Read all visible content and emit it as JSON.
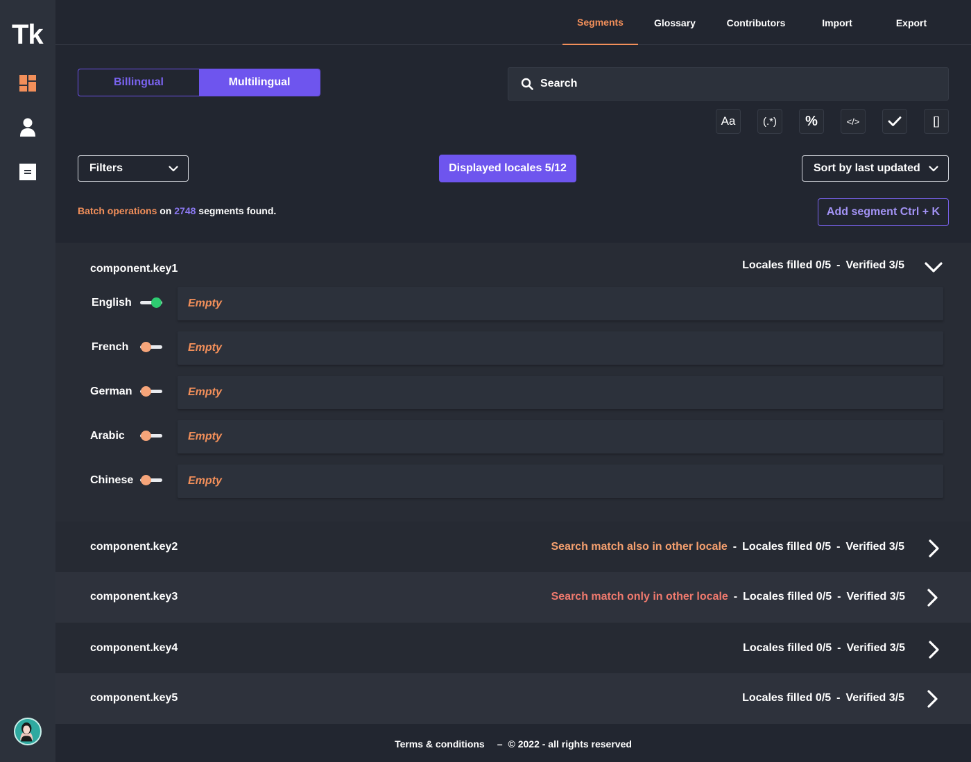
{
  "app": {
    "logo": "Tk"
  },
  "sidebar": {
    "items": [
      {
        "name": "dashboard-icon",
        "color": "#f28f5a"
      },
      {
        "name": "user-icon",
        "color": "#ffffff"
      },
      {
        "name": "document-icon",
        "color": "#ffffff"
      }
    ]
  },
  "nav": {
    "tabs": [
      {
        "label": "Segments",
        "active": true
      },
      {
        "label": "Glossary"
      },
      {
        "label": "Contributors"
      },
      {
        "label": "Import"
      },
      {
        "label": "Export"
      }
    ]
  },
  "mode": {
    "billingual": "Billingual",
    "multilingual": "Multilingual",
    "selected": "Multilingual"
  },
  "search": {
    "placeholder": "Search",
    "options": [
      "Aa",
      "(.*)",
      "%",
      "</>",
      "check-icon",
      "[]"
    ]
  },
  "toolbar": {
    "filters": "Filters",
    "displayed_locales": "Displayed locales 5/12",
    "sort": "Sort by last updated"
  },
  "batch": {
    "link": "Batch operations",
    "on": "on",
    "count": "2748",
    "suffix": "segments found."
  },
  "add_segment": "Add segment Ctrl + K",
  "segments": [
    {
      "key": "component.key1",
      "locales_filled": "Locales filled 0/5",
      "verified": "Verified 3/5",
      "sep": "-",
      "expanded": true,
      "locales": [
        {
          "name": "English",
          "value": "Empty",
          "enabled": true
        },
        {
          "name": "French",
          "value": "Empty",
          "enabled": false
        },
        {
          "name": "German",
          "value": "Empty",
          "enabled": false
        },
        {
          "name": "Arabic",
          "value": "Empty",
          "enabled": false
        },
        {
          "name": "Chinese",
          "value": "Empty",
          "enabled": false
        }
      ]
    },
    {
      "key": "component.key2",
      "match": "Search match also in other locale",
      "locales_filled": "Locales filled 0/5",
      "verified": "Verified 3/5",
      "sep": "-"
    },
    {
      "key": "component.key3",
      "match": "Search match only in other locale",
      "locales_filled": "Locales filled 0/5",
      "verified": "Verified 3/5",
      "sep": "-"
    },
    {
      "key": "component.key4",
      "locales_filled": "Locales filled 0/5",
      "verified": "Verified 3/5",
      "sep": "-"
    },
    {
      "key": "component.key5",
      "locales_filled": "Locales filled 0/5",
      "verified": "Verified 3/5",
      "sep": "-"
    }
  ],
  "footer": {
    "terms": "Terms & conditions",
    "dash": "–",
    "copyright": "© 2022 - all rights reserved"
  },
  "colors": {
    "accent": "#6e55ee",
    "orange": "#f28f5a",
    "switch_on": "#2ecc71",
    "switch_off": "#f6a57a"
  }
}
